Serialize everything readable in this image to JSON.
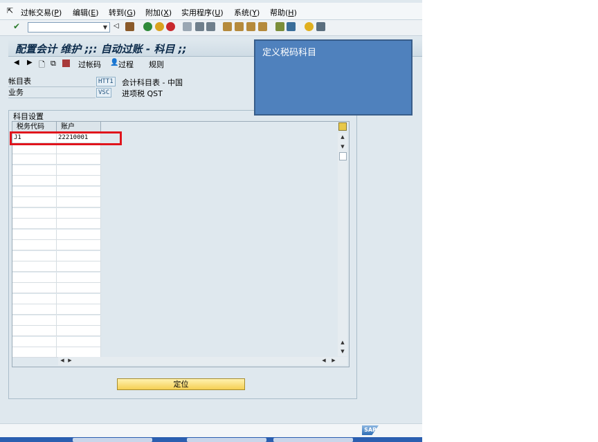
{
  "menubar": {
    "items": [
      {
        "label": "过帐交易(",
        "key": "P",
        "tail": ")"
      },
      {
        "label": "编辑(",
        "key": "E",
        "tail": ")"
      },
      {
        "label": "转到(",
        "key": "G",
        "tail": ")"
      },
      {
        "label": "附加(",
        "key": "X",
        "tail": ")"
      },
      {
        "label": "实用程序(",
        "key": "U",
        "tail": ")"
      },
      {
        "label": "系统(",
        "key": "Y",
        "tail": ")"
      },
      {
        "label": "帮助(",
        "key": "H",
        "tail": ")"
      }
    ]
  },
  "toolbar": {
    "command_field_value": ""
  },
  "screen": {
    "title": "配置会计 维护 ;;: 自动过账 - 科目 ;;",
    "app_toolbar": {
      "rules_label": "过帐码",
      "procedure_label": "过程",
      "rules2_label": "规则"
    }
  },
  "header_fields": [
    {
      "label": "帐目表",
      "value": "HTT1",
      "description": "会计科目表 - 中国"
    },
    {
      "label": "业务",
      "value": "VSC",
      "description": "进项税 QST"
    }
  ],
  "account_group": {
    "title": "科目设置",
    "columns": [
      "税务代码",
      "账户"
    ],
    "rows": [
      [
        "J1",
        "22210001"
      ]
    ]
  },
  "buttons": {
    "locate_label": "定位"
  },
  "callout": {
    "text": "定义税码科目"
  },
  "status": {
    "logo_text": "SAP"
  },
  "colors": {
    "callout_bg": "#4f81bd",
    "highlight_border": "#e0141c",
    "locate_button": "#f5cf52"
  }
}
